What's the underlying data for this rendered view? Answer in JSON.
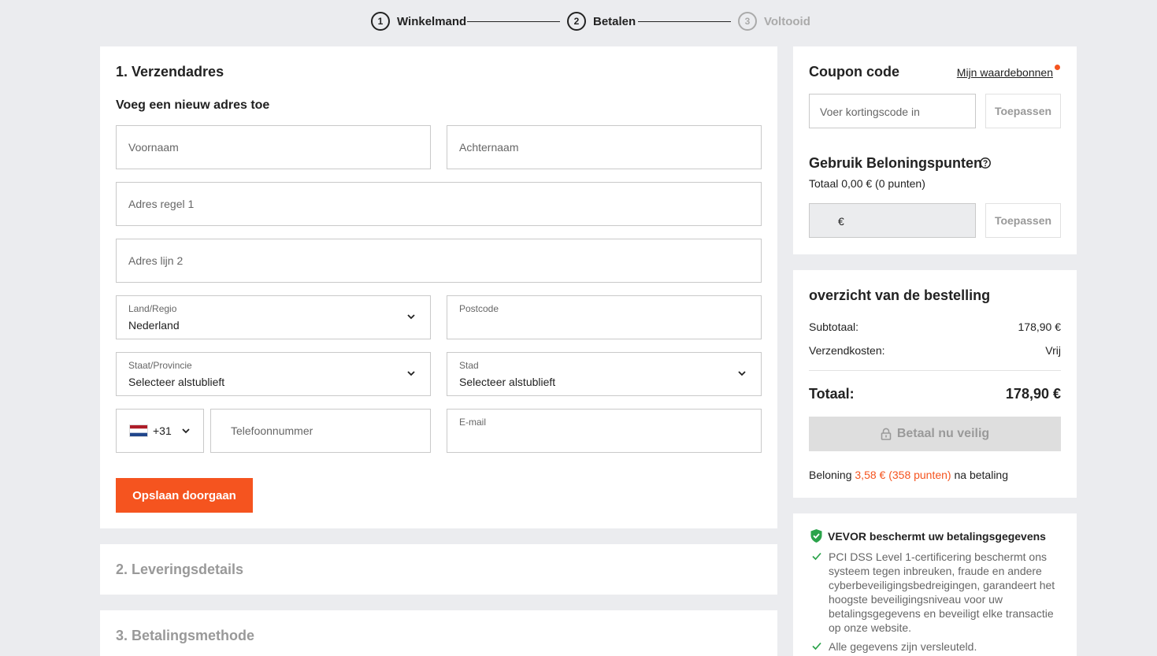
{
  "stepper": {
    "steps": [
      {
        "num": "1",
        "label": "Winkelmand"
      },
      {
        "num": "2",
        "label": "Betalen"
      },
      {
        "num": "3",
        "label": "Voltooid"
      }
    ]
  },
  "shipping": {
    "title": "1. Verzendadres",
    "subtitle": "Voeg een nieuw adres toe",
    "first_name_ph": "Voornaam",
    "last_name_ph": "Achternaam",
    "address1_ph": "Adres regel 1",
    "address2_ph": "Adres lijn 2",
    "country_label": "Land/Regio",
    "country_value": "Nederland",
    "postcode_label": "Postcode",
    "state_label": "Staat/Provincie",
    "state_value": "Selecteer alstublieft",
    "city_label": "Stad",
    "city_value": "Selecteer alstublieft",
    "phone_code": "+31",
    "phone_ph": "Telefoonnummer",
    "email_label": "E-mail",
    "save_button": "Opslaan doorgaan"
  },
  "delivery": {
    "title": "2. Leveringsdetails"
  },
  "payment": {
    "title": "3. Betalingsmethode"
  },
  "coupon": {
    "title": "Coupon code",
    "link": "Mijn waardebonnen",
    "input_ph": "Voer kortingscode in",
    "apply": "Toepassen"
  },
  "rewards": {
    "title": "Gebruik Beloningspunten",
    "total": "Totaal 0,00 € (0 punten)",
    "currency": "€",
    "apply": "Toepassen"
  },
  "summary": {
    "title": "overzicht van de bestelling",
    "subtotal_label": "Subtotaal:",
    "subtotal_value": "178,90 €",
    "shipping_label": "Verzendkosten:",
    "shipping_value": "Vrij",
    "total_label": "Totaal:",
    "total_value": "178,90 €",
    "pay_button": "Betaal nu veilig",
    "reward_prefix": "Beloning",
    "reward_amount": "3,58 € (358 punten)",
    "reward_suffix": "na betaling"
  },
  "security": {
    "title": "VEVOR beschermt uw betalingsgegevens",
    "items": [
      "PCI DSS Level 1-certificering beschermt ons systeem tegen inbreuken, fraude en andere cyberbeveiligingsbedreigingen, garandeert het hoogste beveiligingsniveau voor uw betalingsgegevens en beveiligt elke transactie op onze website.",
      "Alle gegevens zijn versleuteld."
    ]
  },
  "colors": {
    "accent": "#f5541f",
    "green": "#2aa34a",
    "background": "#ebecef"
  }
}
